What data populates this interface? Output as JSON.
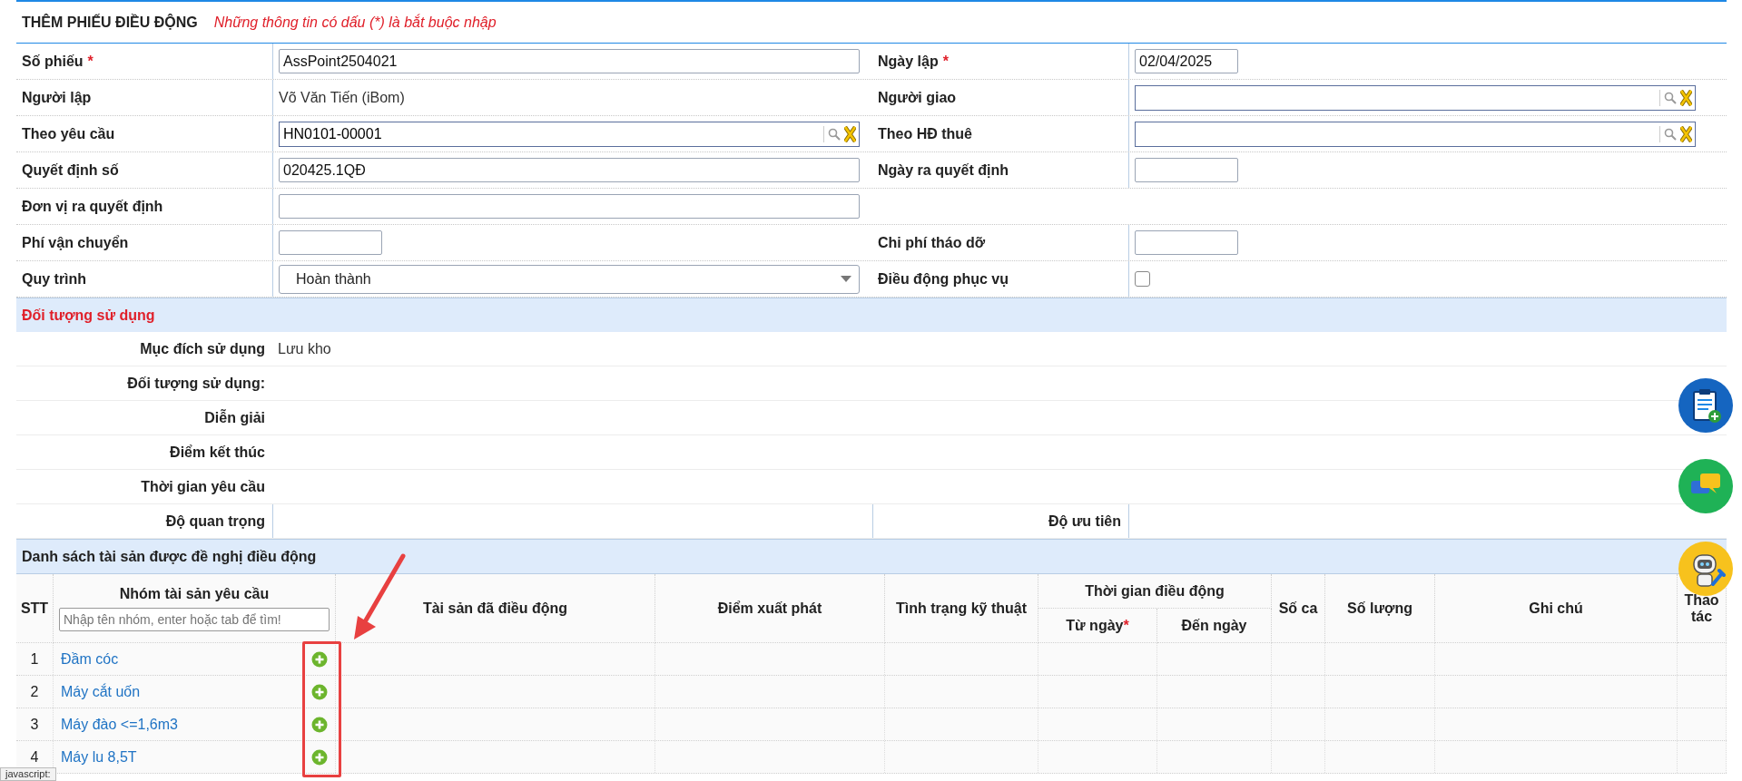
{
  "header": {
    "title": "THÊM PHIẾU ĐIỀU ĐỘNG",
    "note": "Những thông tin có dấu (*) là bắt buộc nhập"
  },
  "form": {
    "rows": [
      {
        "left": {
          "label": "Số phiếu",
          "required_mark": "*",
          "kind": "text",
          "value": "AssPoint2504021"
        },
        "right": {
          "label": "Ngày lập",
          "required_mark": "*",
          "kind": "short",
          "value": "02/04/2025"
        }
      },
      {
        "left": {
          "label": "Người lập",
          "kind": "static",
          "value": "Võ Văn Tiến (iBom)"
        },
        "right": {
          "label": "Người giao",
          "kind": "lookup"
        }
      },
      {
        "left": {
          "label": "Theo yêu cầu",
          "kind": "lookup",
          "value": "HN0101-00001"
        },
        "right": {
          "label": "Theo HĐ thuê",
          "kind": "lookup"
        }
      },
      {
        "left": {
          "label": "Quyết định số",
          "kind": "text",
          "value": "020425.1QĐ"
        },
        "right": {
          "label": "Ngày ra quyết định",
          "kind": "short"
        }
      },
      {
        "left": {
          "label": "Đơn vị ra quyết định",
          "kind": "text"
        }
      },
      {
        "left": {
          "label": "Phí vận chuyển",
          "kind": "short"
        },
        "right": {
          "label": "Chi phí tháo dỡ",
          "kind": "short"
        }
      },
      {
        "left": {
          "label": "Quy trình",
          "kind": "select",
          "value": "Hoàn thành"
        },
        "right": {
          "label": "Điều động phục vụ",
          "kind": "checkbox",
          "checked": false
        }
      }
    ]
  },
  "usage": {
    "title": "Đối tượng sử dụng",
    "rows": [
      {
        "label": "Mục đích sử dụng",
        "value": "Lưu kho"
      },
      {
        "label": "Đối tượng sử dụng:"
      },
      {
        "label": "Diễn giải"
      },
      {
        "label": "Điểm kết thúc"
      },
      {
        "label": "Thời gian yêu cầu"
      },
      {
        "label": "Độ quan trọng",
        "right_label": "Độ ưu tiên"
      }
    ]
  },
  "assets": {
    "title": "Danh sách tài sản được đề nghị điều động",
    "columns": [
      {
        "label": "STT"
      },
      {
        "label": "Nhóm tài sản yêu cầu",
        "placeholder": "Nhập tên nhóm, enter hoặc tab để tìm!"
      },
      {
        "label": "Tài sản đã điều động"
      },
      {
        "label": "Điểm xuất phát"
      },
      {
        "label": "Tình trạng kỹ thuật"
      },
      {
        "label": "Thời gian điều động",
        "children": [
          {
            "label": "Từ ngày",
            "required_mark": "*"
          },
          {
            "label": "Đến ngày"
          }
        ]
      },
      {
        "label": "Số ca"
      },
      {
        "label": "Số lượng"
      },
      {
        "label": "Ghi chú"
      },
      {
        "label": "Thao tác"
      }
    ],
    "rows": [
      {
        "stt": "1",
        "name": "Đầm cóc"
      },
      {
        "stt": "2",
        "name": "Máy cắt uốn"
      },
      {
        "stt": "3",
        "name": "Máy đào <=1,6m3"
      },
      {
        "stt": "4",
        "name": "Máy lu 8,5T"
      }
    ]
  },
  "status_tooltip": "javascript:"
}
